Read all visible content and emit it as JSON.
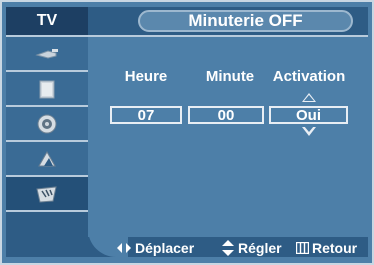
{
  "sidebar": {
    "title": "TV",
    "items": [
      {
        "icon": "antenna-icon"
      },
      {
        "icon": "picture-icon"
      },
      {
        "icon": "speaker-icon"
      },
      {
        "icon": "channel-icon"
      },
      {
        "icon": "setup-icon"
      }
    ]
  },
  "header": {
    "title": "Minuterie OFF"
  },
  "timer": {
    "columns": [
      "Heure",
      "Minute",
      "Activation"
    ],
    "hour": "07",
    "minute": "00",
    "activation": "Oui"
  },
  "footer": {
    "move_label": "Déplacer",
    "adjust_label": "Régler",
    "return_label": "Retour"
  },
  "colors": {
    "background": "#4d7fa8",
    "sidebar": "#2e5c85",
    "text": "#ffffff"
  }
}
